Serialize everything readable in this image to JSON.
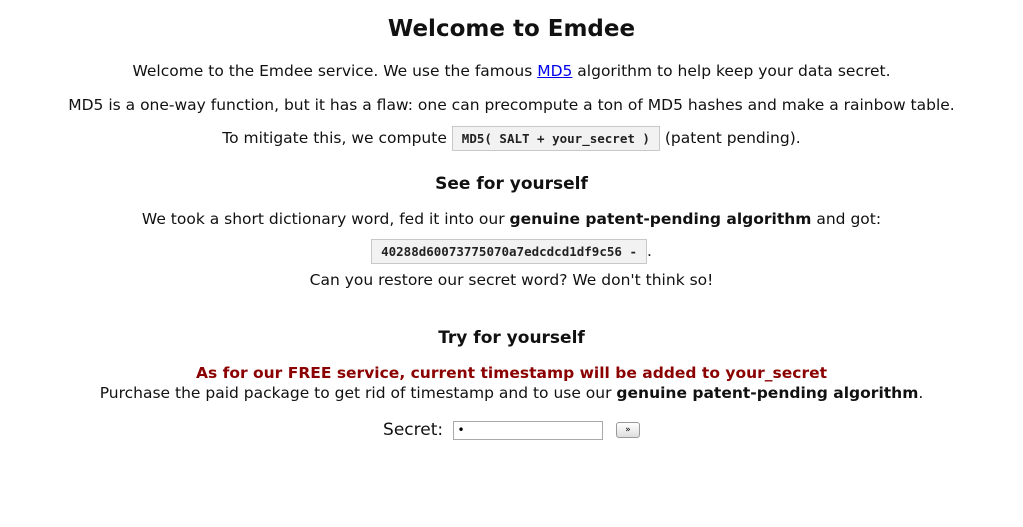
{
  "page": {
    "title": "Welcome to Emdee"
  },
  "intro": {
    "line1_before": "Welcome to the Emdee service. We use the famous ",
    "link_md5": "MD5",
    "line1_after": " algorithm to help keep your data secret.",
    "line2": "MD5 is a one-way function, but it has a flaw: one can precompute a ton of MD5 hashes and make a rainbow table.",
    "line3_before": "To mitigate this, we compute ",
    "formula": "MD5( SALT + your_secret )",
    "line3_after": " (patent pending)."
  },
  "see_section": {
    "heading": "See for yourself",
    "line_before": "We took a short dictionary word, fed it into our ",
    "line_bold": "genuine patent-pending algorithm",
    "line_after": " and got:",
    "hash": "40288d60073775070a7edcdcd1df9c56  -",
    "hash_suffix": ".",
    "question": "Can you restore our secret word? We don't think so!"
  },
  "try_section": {
    "heading": "Try for yourself",
    "warning": "As for our FREE service, current timestamp will be added to your_secret",
    "purchase_before": "Purchase the paid package to get rid of timestamp and to use our ",
    "purchase_bold": "genuine patent-pending algorithm",
    "purchase_after": ".",
    "secret_label": "Secret:",
    "secret_value": "•",
    "submit_label": "»"
  },
  "colors": {
    "warning": "#8b0000",
    "link": "#0000ee",
    "code_background": "#f2f2f2"
  }
}
